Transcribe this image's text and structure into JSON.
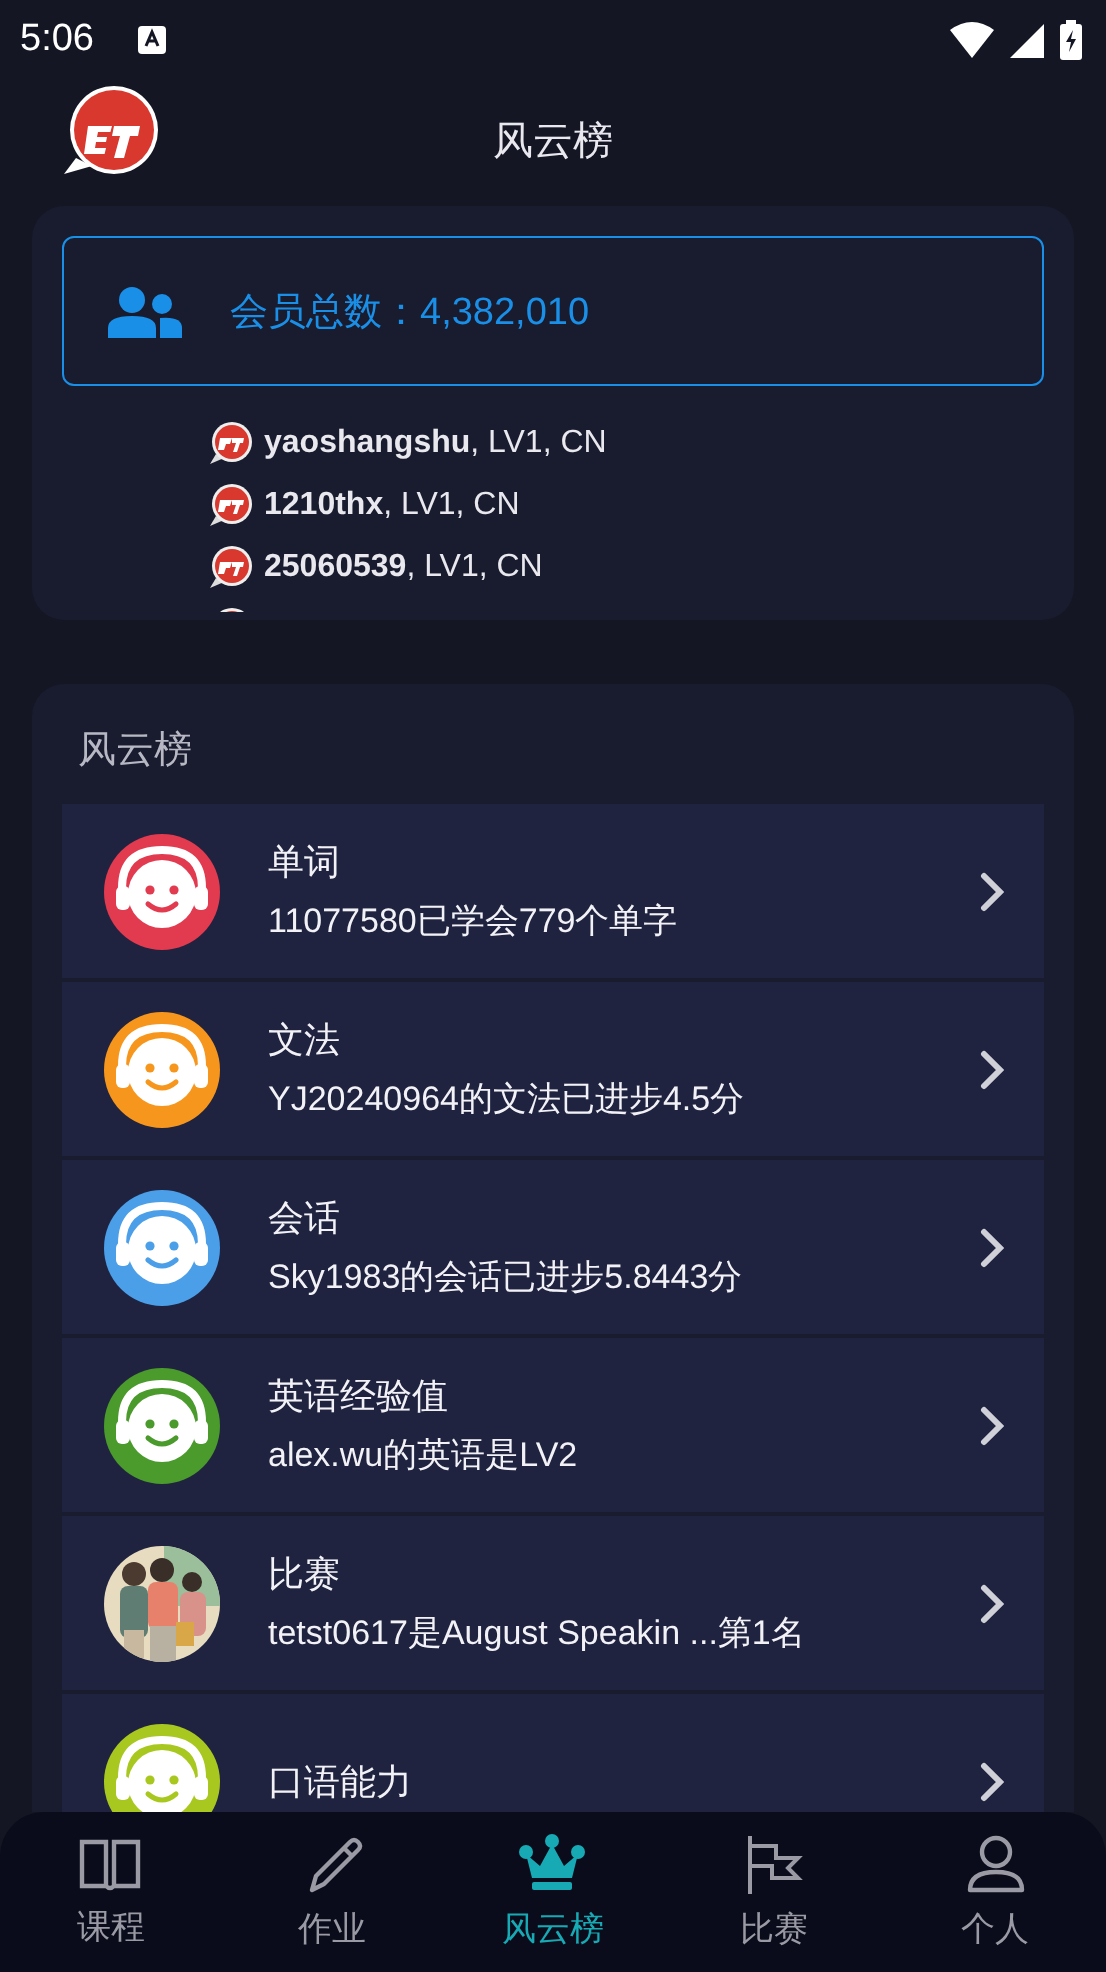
{
  "status_bar": {
    "time": "5:06"
  },
  "header": {
    "title": "风云榜"
  },
  "members": {
    "label": "会员总数：4,382,010",
    "recent": [
      {
        "text": "**yaoshangshu**, LV1, CN"
      },
      {
        "text": "**1210thx**, LV1, CN"
      },
      {
        "text": "**25060539**, LV1, CN"
      }
    ]
  },
  "ranking": {
    "title": "风云榜",
    "items": [
      {
        "kind": "headset",
        "color": "#e23a4f",
        "title": "单词",
        "subtitle": "11077580已学会779个单字"
      },
      {
        "kind": "headset",
        "color": "#f7961c",
        "title": "文法",
        "subtitle": "YJ20240964的文法已进步4.5分"
      },
      {
        "kind": "headset",
        "color": "#4b9ee8",
        "title": "会话",
        "subtitle": "Sky1983的会话已进步5.8443分"
      },
      {
        "kind": "headset",
        "color": "#4a9a2c",
        "title": "英语经验值",
        "subtitle": "alex.wu的英语是LV2"
      },
      {
        "kind": "picture",
        "title": "比赛",
        "subtitle": "tetst0617是August Speakin ...第1名"
      },
      {
        "kind": "headset",
        "color": "#a8c820",
        "title": "口语能力"
      }
    ]
  },
  "nav": [
    {
      "kind": "book",
      "label": "课程",
      "selected": false
    },
    {
      "kind": "pencil",
      "label": "作业",
      "selected": false
    },
    {
      "kind": "crown",
      "label": "风云榜",
      "selected": true
    },
    {
      "kind": "flag",
      "label": "比赛",
      "selected": false
    },
    {
      "kind": "person",
      "label": "个人",
      "selected": false
    }
  ]
}
